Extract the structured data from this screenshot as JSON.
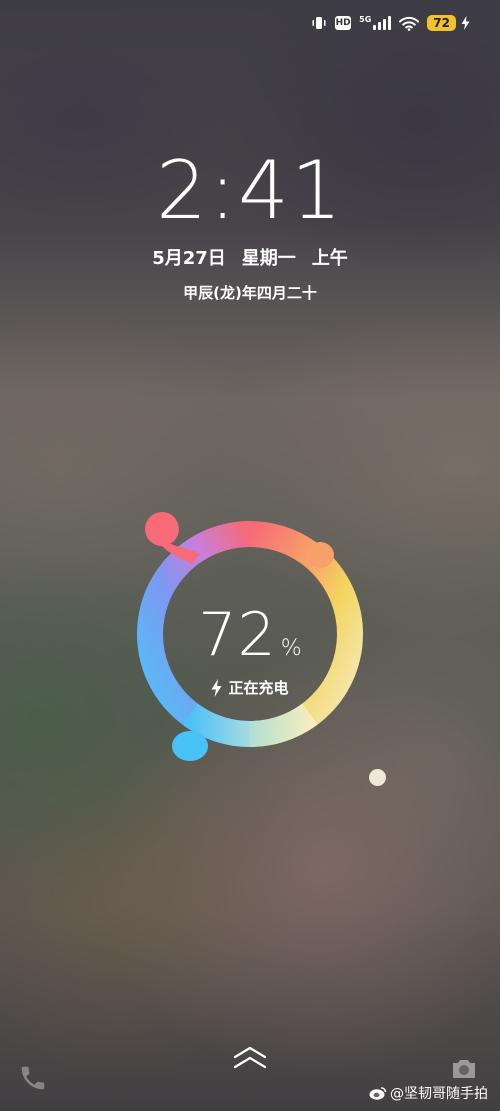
{
  "status_bar": {
    "hd_label": "HD",
    "network_label": "5G",
    "battery_level": "72",
    "icons": [
      "vibrate-icon",
      "hd-icon",
      "signal-5g-icon",
      "wifi-icon",
      "battery-icon",
      "charging-bolt-icon"
    ]
  },
  "lockscreen": {
    "time": "2:41",
    "date": "5月27日",
    "weekday": "星期一",
    "period": "上午",
    "lunar": "甲辰(龙)年四月二十"
  },
  "charging": {
    "percent": "72",
    "percent_sign": "%",
    "status": "正在充电",
    "level_fraction": 0.72,
    "ring_colors": [
      "#f76a77",
      "#f8a06a",
      "#f3d45e",
      "#f6edc5",
      "#62c9f5",
      "#4fa6f7",
      "#a68af0"
    ]
  },
  "bottom": {
    "shortcut_left_icon": "phone-icon",
    "unlock_icon": "swipe-up-icon",
    "shortcut_right_icon": "camera-icon",
    "watermark": "@坚韧哥随手拍"
  }
}
